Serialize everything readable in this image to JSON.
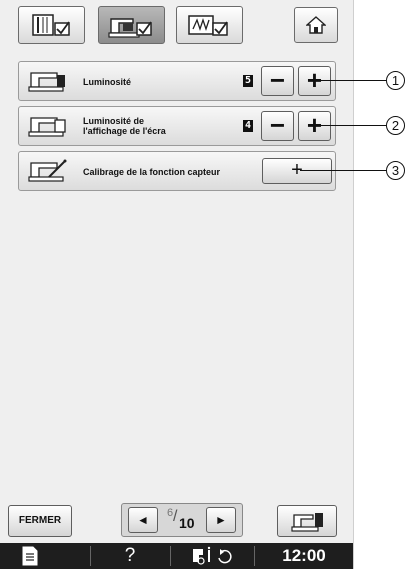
{
  "tabs": [
    {
      "icon": "utility-settings-icon",
      "state": "inactive"
    },
    {
      "icon": "sewing-settings-icon",
      "state": "active"
    },
    {
      "icon": "embroidery-settings-icon",
      "state": "inactive"
    }
  ],
  "home": {
    "icon": "home-icon"
  },
  "settings": [
    {
      "icon": "machine-light-icon",
      "label_lines": [
        "Luminosité"
      ],
      "value": "5",
      "minus": "−",
      "plus": "+"
    },
    {
      "icon": "machine-display-icon",
      "label_lines": [
        "Luminosité de",
        "l'affichage de l'écra"
      ],
      "value": "4",
      "minus": "−",
      "plus": "+"
    },
    {
      "icon": "machine-sensor-icon",
      "label_lines": [
        "Calibrage de la fonction capteur"
      ],
      "button": "+"
    }
  ],
  "callouts": [
    "1",
    "2",
    "3"
  ],
  "footer": {
    "close_label": "FERMER",
    "prev_arrow": "◄",
    "next_arrow": "►",
    "page_current": "6",
    "page_total": "10",
    "machine_icon": "machine-view-icon"
  },
  "statusbar": {
    "doc_icon": "document-icon",
    "help_label": "?",
    "presser_icon": "presser-foot-icon",
    "rotate_icon": "rotate-icon",
    "time": "12:00"
  },
  "colors": {
    "background": "#efefef",
    "statusbar": "#1e1e1e",
    "active_tab": "#8c8c8c"
  }
}
